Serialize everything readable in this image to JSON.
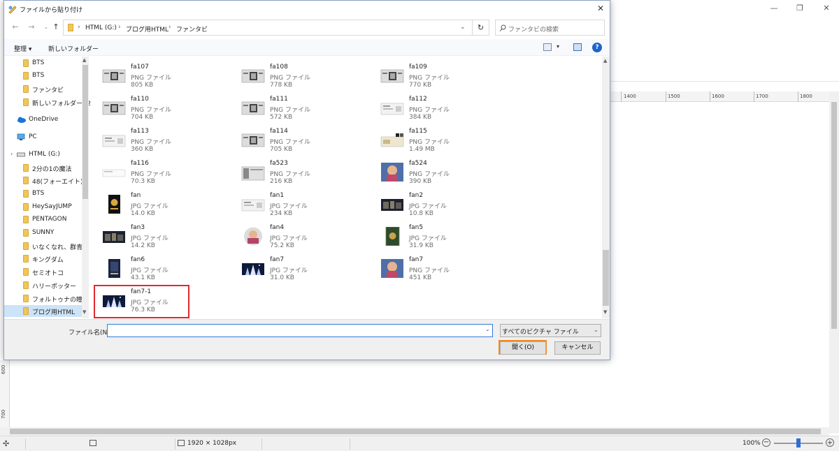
{
  "background_app": {
    "ruler_labels": [
      "1400",
      "1500",
      "1600",
      "1700",
      "1800"
    ],
    "left_ruler_labels": [
      "600",
      "700"
    ],
    "status": {
      "dimensions": "1920 × 1028px",
      "zoom": "100%"
    }
  },
  "dialog": {
    "title": "ファイルから貼り付け",
    "breadcrumb": [
      "HTML (G:)",
      "ブログ用HTML",
      "ファンタビ"
    ],
    "search_placeholder": "ファンタビの検索",
    "toolbar": {
      "organize": "整理 ▾",
      "new_folder": "新しいフォルダー"
    },
    "nav_items": [
      {
        "label": "BTS",
        "type": "folder"
      },
      {
        "label": "BTS",
        "type": "folder"
      },
      {
        "label": "ファンタビ",
        "type": "folder"
      },
      {
        "label": "新しいフォルダー (2",
        "type": "folder"
      },
      {
        "label": "OneDrive",
        "type": "cloud"
      },
      {
        "label": "PC",
        "type": "pc"
      },
      {
        "label": "HTML (G:)",
        "type": "drive"
      },
      {
        "label": "2分の1の魔法",
        "type": "folder"
      },
      {
        "label": "48(フォーエイト)",
        "type": "folder"
      },
      {
        "label": "BTS",
        "type": "folder"
      },
      {
        "label": "HeySayJUMP",
        "type": "folder"
      },
      {
        "label": "PENTAGON",
        "type": "folder"
      },
      {
        "label": "SUNNY",
        "type": "folder"
      },
      {
        "label": "いなくなれ、群青",
        "type": "folder"
      },
      {
        "label": "キングダム",
        "type": "folder"
      },
      {
        "label": "セミオトコ",
        "type": "folder"
      },
      {
        "label": "ハリーポッター",
        "type": "folder"
      },
      {
        "label": "フォルトゥナの瞳",
        "type": "folder"
      },
      {
        "label": "ブログ用HTML",
        "type": "folder",
        "selected": true
      }
    ],
    "files": [
      {
        "name": "fa107",
        "type": "PNG ファイル",
        "size": "805 KB",
        "thumb": "screen"
      },
      {
        "name": "fa108",
        "type": "PNG ファイル",
        "size": "778 KB",
        "thumb": "screen"
      },
      {
        "name": "fa109",
        "type": "PNG ファイル",
        "size": "770 KB",
        "thumb": "screen"
      },
      {
        "name": "fa110",
        "type": "PNG ファイル",
        "size": "704 KB",
        "thumb": "screen"
      },
      {
        "name": "fa111",
        "type": "PNG ファイル",
        "size": "572 KB",
        "thumb": "screen"
      },
      {
        "name": "fa112",
        "type": "PNG ファイル",
        "size": "384 KB",
        "thumb": "light"
      },
      {
        "name": "fa113",
        "type": "PNG ファイル",
        "size": "360 KB",
        "thumb": "light"
      },
      {
        "name": "fa114",
        "type": "PNG ファイル",
        "size": "705 KB",
        "thumb": "screen"
      },
      {
        "name": "fa115",
        "type": "PNG ファイル",
        "size": "1.49 MB",
        "thumb": "sepia"
      },
      {
        "name": "fa116",
        "type": "PNG ファイル",
        "size": "70.3 KB",
        "thumb": "blank"
      },
      {
        "name": "fa523",
        "type": "PNG ファイル",
        "size": "216 KB",
        "thumb": "grey"
      },
      {
        "name": "fa524",
        "type": "PNG ファイル",
        "size": "390 KB",
        "thumb": "portrait"
      },
      {
        "name": "fan",
        "type": "JPG ファイル",
        "size": "14.0 KB",
        "thumb": "poster"
      },
      {
        "name": "fan1",
        "type": "JPG ファイル",
        "size": "234 KB",
        "thumb": "light"
      },
      {
        "name": "fan2",
        "type": "JPG ファイル",
        "size": "10.8 KB",
        "thumb": "dark"
      },
      {
        "name": "fan3",
        "type": "JPG ファイル",
        "size": "14.2 KB",
        "thumb": "dark"
      },
      {
        "name": "fan4",
        "type": "JPG ファイル",
        "size": "75.2 KB",
        "thumb": "round"
      },
      {
        "name": "fan5",
        "type": "JPG ファイル",
        "size": "31.9 KB",
        "thumb": "book"
      },
      {
        "name": "fan6",
        "type": "JPG ファイル",
        "size": "43.1 KB",
        "thumb": "poster-dark"
      },
      {
        "name": "fan7",
        "type": "JPG ファイル",
        "size": "31.0 KB",
        "thumb": "castle"
      },
      {
        "name": "fan7",
        "type": "PNG ファイル",
        "size": "451 KB",
        "thumb": "portrait"
      },
      {
        "name": "fan7-1",
        "type": "JPG ファイル",
        "size": "76.3 KB",
        "thumb": "castle"
      }
    ],
    "filename_label": "ファイル名(N):",
    "filename_value": "",
    "filter_selected": "すべてのピクチャ ファイル",
    "open_label": "開く(O)",
    "cancel_label": "キャンセル",
    "colors": {
      "highlight_red": "#e0282e",
      "highlight_orange": "#f08a24",
      "selection_blue": "#cde3f7"
    }
  }
}
